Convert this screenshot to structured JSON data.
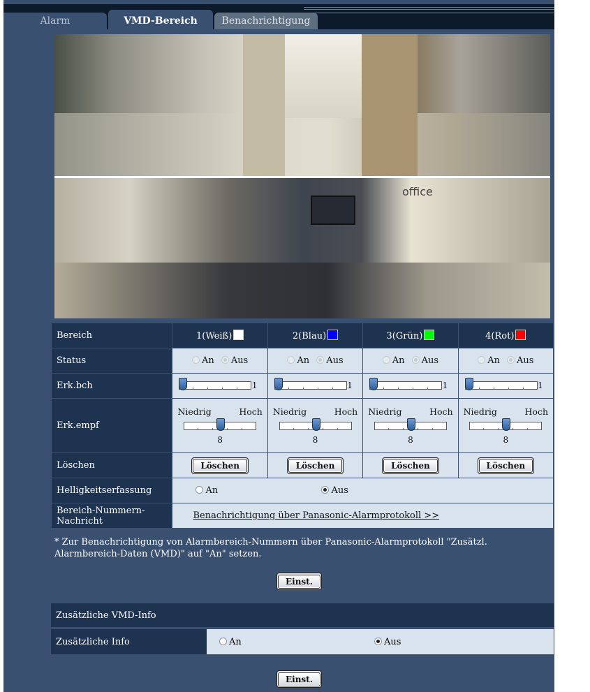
{
  "tabs": [
    {
      "label": "Alarm"
    },
    {
      "label": "VMD-Bereich"
    },
    {
      "label": "Benachrichtigung"
    }
  ],
  "camera": {
    "office_sign": "office"
  },
  "grid": {
    "bereich_label": "Bereich",
    "areas": [
      {
        "name": "1(Weiß)",
        "color": "#ffffff"
      },
      {
        "name": "2(Blau)",
        "color": "#0000ff"
      },
      {
        "name": "3(Grün)",
        "color": "#00ff00"
      },
      {
        "name": "4(Rot)",
        "color": "#ff0000"
      }
    ],
    "status_label": "Status",
    "status_on": "An",
    "status_off": "Aus",
    "status_value": "Aus",
    "erk_bch_label": "Erk.bch",
    "erk_bch_value": "1",
    "erk_empf_label": "Erk.empf",
    "empf_low": "Niedrig",
    "empf_high": "Hoch",
    "empf_value": "8",
    "loeschen_label": "Löschen",
    "loeschen_button": "Löschen",
    "helligkeit_label": "Helligkeitserfassung",
    "helligkeit_on": "An",
    "helligkeit_off": "Aus",
    "helligkeit_value": "Aus",
    "nachricht_label": "Bereich-Nummern-Nachricht",
    "nachricht_link": "Benachrichtigung über Panasonic-Alarmprotokoll >>"
  },
  "note": "* Zur Benachrichtigung von Alarmbereich-Nummern über Panasonic-Alarmprotokoll \"Zusätzl. Alarmbereich-Daten (VMD)\" auf \"An\" setzen.",
  "einst_label": "Einst.",
  "zusatz": {
    "section_title": "Zusätzliche VMD-Info",
    "info_label": "Zusätzliche Info",
    "on": "An",
    "off": "Aus",
    "value": "Aus"
  }
}
